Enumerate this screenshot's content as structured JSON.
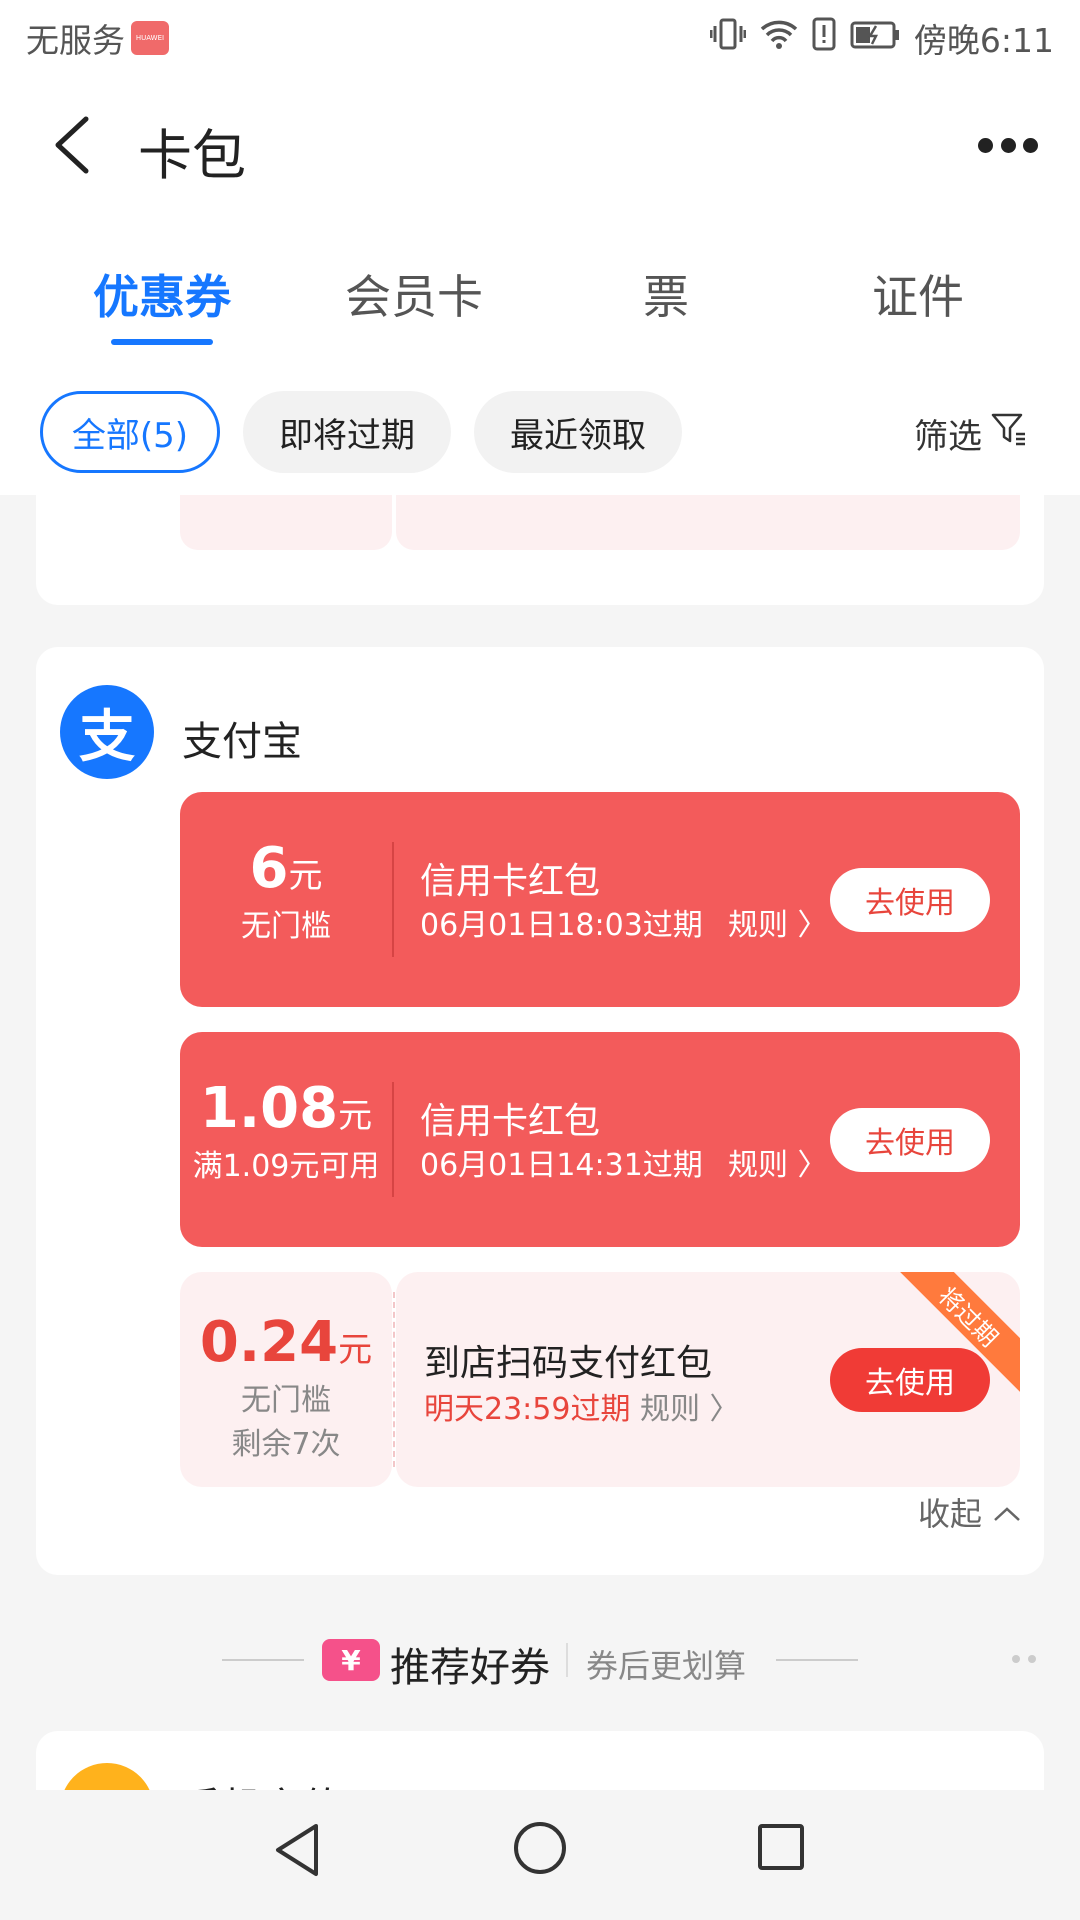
{
  "status_bar": {
    "carrier": "无服务",
    "time": "傍晚6:11",
    "icons": [
      "huawei-icon",
      "vibrate-icon",
      "wifi-icon",
      "alert-icon",
      "battery-icon"
    ]
  },
  "header": {
    "title": "卡包",
    "back_icon": "back-arrow-icon",
    "more_icon": "more-icon"
  },
  "tabs": [
    {
      "label": "优惠券",
      "active": true
    },
    {
      "label": "会员卡",
      "active": false
    },
    {
      "label": "票",
      "active": false
    },
    {
      "label": "证件",
      "active": false
    }
  ],
  "filters": {
    "chips": [
      {
        "label": "全部(5)",
        "active": true
      },
      {
        "label": "即将过期",
        "active": false
      },
      {
        "label": "最近领取",
        "active": false
      }
    ],
    "filter_label": "筛选"
  },
  "alipay_section": {
    "logo_glyph": "支",
    "name": "支付宝",
    "coupons": [
      {
        "amount": "6",
        "unit": "元",
        "condition": "无门槛",
        "title": "信用卡红包",
        "expire": "06月01日18:03过期",
        "rule": "规则",
        "button": "去使用"
      },
      {
        "amount": "1.08",
        "unit": "元",
        "condition": "满1.09元可用",
        "title": "信用卡红包",
        "expire": "06月01日14:31过期",
        "rule": "规则",
        "button": "去使用"
      },
      {
        "amount": "0.24",
        "unit": "元",
        "condition": "无门槛",
        "remaining": "剩余7次",
        "title": "到店扫码支付红包",
        "expire": "明天23:59过期",
        "rule": "规则",
        "button": "去使用",
        "ribbon": "将过期"
      }
    ],
    "collapse_label": "收起"
  },
  "recommend": {
    "badge": "¥",
    "title": "推荐好券",
    "subtitle": "券后更划算"
  },
  "next_section": {
    "name": "手机充值"
  },
  "colors": {
    "accent": "#1677ff",
    "coupon_red": "#f35b5b",
    "coupon_pink": "#fdf0f1",
    "use_button_red": "#f03b36",
    "ribbon_orange": "#ff7a3d"
  }
}
